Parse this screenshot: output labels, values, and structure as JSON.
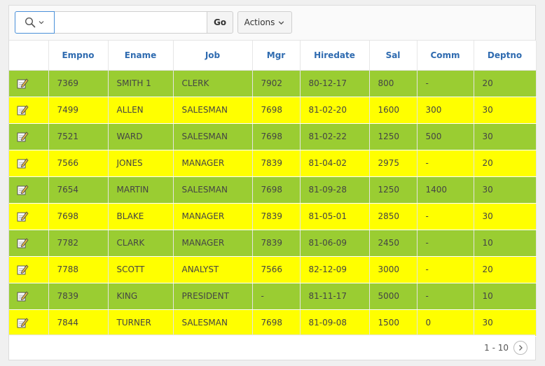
{
  "toolbar": {
    "search_icon": "search-icon",
    "search_value": "",
    "search_placeholder": "",
    "go_label": "Go",
    "actions_label": "Actions"
  },
  "table": {
    "columns": [
      "",
      "Empno",
      "Ename",
      "Job",
      "Mgr",
      "Hiredate",
      "Sal",
      "Comm",
      "Deptno"
    ],
    "row_colors": {
      "green": "#9acd32",
      "yellow": "#ffff00"
    },
    "rows": [
      {
        "color": "green",
        "cells": [
          "7369",
          "SMITH 1",
          "CLERK",
          "7902",
          "80-12-17",
          "800",
          "-",
          "20"
        ]
      },
      {
        "color": "yellow",
        "cells": [
          "7499",
          "ALLEN",
          "SALESMAN",
          "7698",
          "81-02-20",
          "1600",
          "300",
          "30"
        ]
      },
      {
        "color": "green",
        "cells": [
          "7521",
          "WARD",
          "SALESMAN",
          "7698",
          "81-02-22",
          "1250",
          "500",
          "30"
        ]
      },
      {
        "color": "yellow",
        "cells": [
          "7566",
          "JONES",
          "MANAGER",
          "7839",
          "81-04-02",
          "2975",
          "-",
          "20"
        ]
      },
      {
        "color": "green",
        "cells": [
          "7654",
          "MARTIN",
          "SALESMAN",
          "7698",
          "81-09-28",
          "1250",
          "1400",
          "30"
        ]
      },
      {
        "color": "yellow",
        "cells": [
          "7698",
          "BLAKE",
          "MANAGER",
          "7839",
          "81-05-01",
          "2850",
          "-",
          "30"
        ]
      },
      {
        "color": "green",
        "cells": [
          "7782",
          "CLARK",
          "MANAGER",
          "7839",
          "81-06-09",
          "2450",
          "-",
          "10"
        ]
      },
      {
        "color": "yellow",
        "cells": [
          "7788",
          "SCOTT",
          "ANALYST",
          "7566",
          "82-12-09",
          "3000",
          "-",
          "20"
        ]
      },
      {
        "color": "green",
        "cells": [
          "7839",
          "KING",
          "PRESIDENT",
          "-",
          "81-11-17",
          "5000",
          "-",
          "10"
        ]
      },
      {
        "color": "yellow",
        "cells": [
          "7844",
          "TURNER",
          "SALESMAN",
          "7698",
          "81-09-08",
          "1500",
          "0",
          "30"
        ]
      }
    ]
  },
  "pagination": {
    "label": "1 - 10",
    "next_icon": "chevron-right-icon"
  }
}
